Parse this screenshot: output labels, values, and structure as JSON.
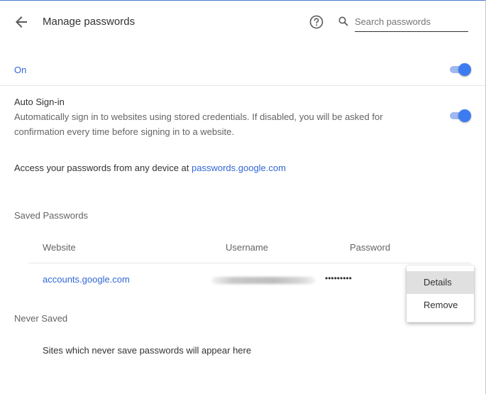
{
  "header": {
    "title": "Manage passwords",
    "search": {
      "placeholder": "Search passwords",
      "value": ""
    }
  },
  "enable": {
    "label": "On",
    "toggle_on": true
  },
  "auto_signin": {
    "title": "Auto Sign-in",
    "description": "Automatically sign in to websites using stored credentials. If disabled, you will be asked for confirmation every time before signing in to a website.",
    "toggle_on": true
  },
  "access": {
    "prefix": "Access your passwords from any device at ",
    "link_text": "passwords.google.com"
  },
  "saved_passwords": {
    "heading": "Saved Passwords",
    "columns": {
      "website": "Website",
      "username": "Username",
      "password": "Password"
    },
    "rows": [
      {
        "website": "accounts.google.com",
        "username": "",
        "password": "•••••••••"
      }
    ]
  },
  "context_menu": {
    "items": [
      {
        "label": "Details",
        "highlighted": true
      },
      {
        "label": "Remove",
        "highlighted": false
      }
    ]
  },
  "never_saved": {
    "heading": "Never Saved",
    "empty_text": "Sites which never save passwords will appear here"
  },
  "colors": {
    "accent": "#3367d6",
    "toggle_knob": "#3d7cf0",
    "toggle_track": "#9fb8ef",
    "menu_highlight": "#e0e0e0"
  },
  "icons": {
    "back": "arrow-back-icon",
    "help": "help-icon",
    "search": "search-icon"
  }
}
